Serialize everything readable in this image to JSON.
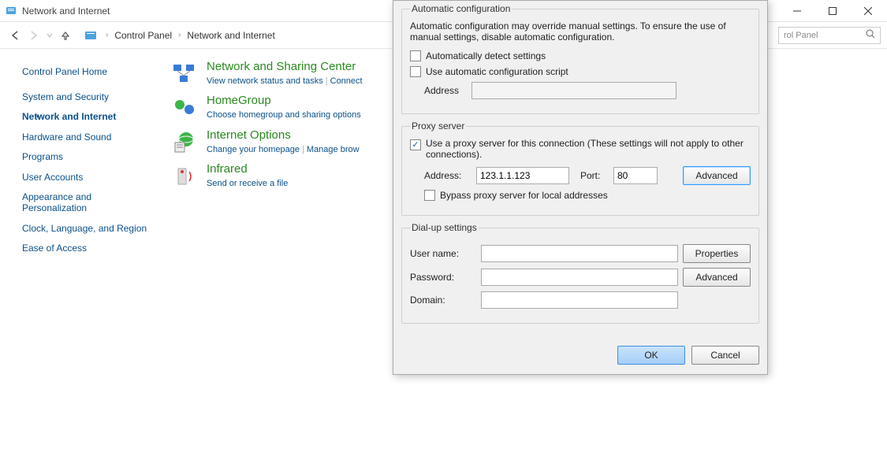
{
  "window": {
    "title": "Network and Internet"
  },
  "breadcrumb": {
    "item1": "Control Panel",
    "item2": "Network and Internet"
  },
  "search": {
    "placeholder": "rol Panel"
  },
  "sidebar": {
    "home": "Control Panel Home",
    "items": [
      "System and Security",
      "Network and Internet",
      "Hardware and Sound",
      "Programs",
      "User Accounts",
      "Appearance and Personalization",
      "Clock, Language, and Region",
      "Ease of Access"
    ]
  },
  "categories": {
    "c1": {
      "title": "Network and Sharing Center",
      "l1": "View network status and tasks",
      "l2": "Connect"
    },
    "c2": {
      "title": "HomeGroup",
      "l1": "Choose homegroup and sharing options"
    },
    "c3": {
      "title": "Internet Options",
      "l1": "Change your homepage",
      "l2": "Manage brow"
    },
    "c4": {
      "title": "Infrared",
      "l1": "Send or receive a file"
    }
  },
  "dialog": {
    "autoconf": {
      "legend": "Automatic configuration",
      "desc": "Automatic configuration may override manual settings.  To ensure the use of manual settings, disable automatic configuration.",
      "chk1": "Automatically detect settings",
      "chk2": "Use automatic configuration script",
      "addr_label": "Address"
    },
    "proxy": {
      "legend": "Proxy server",
      "chk": "Use a proxy server for this connection (These settings will not apply to other connections).",
      "addr_label": "Address:",
      "addr_val": "123.1.1.123",
      "port_label": "Port:",
      "port_val": "80",
      "adv_btn": "Advanced",
      "bypass": "Bypass proxy server for local addresses"
    },
    "dialup": {
      "legend": "Dial-up settings",
      "user_label": "User name:",
      "pass_label": "Password:",
      "domain_label": "Domain:",
      "props_btn": "Properties",
      "adv_btn": "Advanced"
    },
    "footer": {
      "ok": "OK",
      "cancel": "Cancel"
    }
  }
}
